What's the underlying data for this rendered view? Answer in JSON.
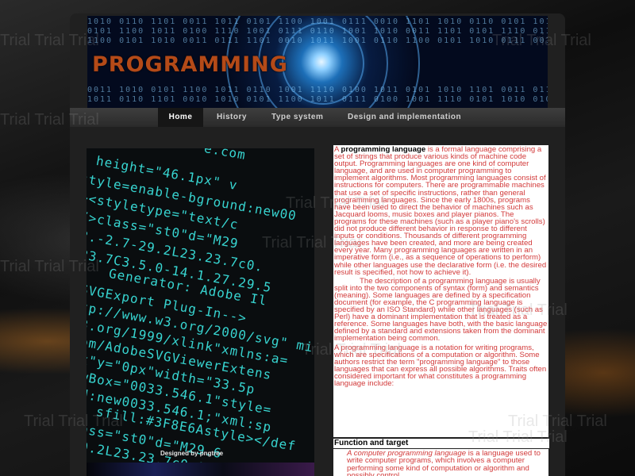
{
  "banner": {
    "title": "PROGRAMMING"
  },
  "nav": {
    "items": [
      {
        "label": "Home",
        "active": true
      },
      {
        "label": "History",
        "active": false
      },
      {
        "label": "Type system",
        "active": false
      },
      {
        "label": "Design and implementation",
        "active": false
      }
    ]
  },
  "photo": {
    "credit": "Designed by pngtree",
    "code_lines": [
      "e.com",
      "height=\"46.1px\" v",
      "style=enable-bground:new00",
      "><styletype=\"text/c",
      "/>class=\"st0\"d=\"M29",
      "2.-2.7-29.2L23.23.7c0.",
      "23.7C3.5.0-14.1.27.29.5",
      "Generator: Adobe Il",
      "SVGExport Plug-In-->",
      "tp://www.w3.org/2000/svg\" mi",
      "3.org/1999/xlink\"xmlns:a=",
      "om/AdobeSVGViewerExtens",
      "x\"y=\"0px\"width=\"33.5p",
      "wBox=\"0033.546.1\"style=",
      "d:new0033.546.1;\"xml:sp",
      "sfill:#3F8E6Astyle></def",
      "ass=\"st0\"d=\"M29.6",
      "9.2L23.23.7c0.0"
    ]
  },
  "article": {
    "intro_prefix": "A ",
    "intro_term": "programming language",
    "intro_rest": " is a formal language comprising a set of strings that produce various kinds of machine code output. Programming languages are one kind of computer language, and are used in computer programming to implement algorithms.     Most programming languages consist of instructions for computers. There are programmable machines that use a set of specific instructions, rather than general programming languages. Since the early 1800s, programs have been used to direct the behavior of machines such as Jacquard looms, music boxes and player pianos. The programs for these machines (such as a player piano's scrolls) did not produce different behavior in response to different inputs or conditions. Thousands of different programming languages have been created, and more are being created every year. Many programming languages are written in an imperative form (i.e., as a sequence of operations to perform) while other languages use the declarative form (i.e. the desired result is specified, not how to achieve it).",
    "paragraph2": "The description of a programming language is usually split into the two components of syntax (form) and semantics (meaning). Some languages are defined by a specification document (for example, the C programming language is specified by an ISO Standard) while other languages (such as Perl) have a dominant implementation that is treated as a reference. Some languages have both, with the basic language defined by a standard and extensions taken from the dominant implementation being common.",
    "paragraph3": "A programming language is a notation for writing programs, which are specifications of a computation or algorithm. Some authors restrict the term \"programming language\" to those languages that can express all possible algorithms. Traits often considered important for what constitutes a programming language include:"
  },
  "section": {
    "heading": "Function and target",
    "quote_em": "A computer programming language",
    "quote_rest": " is a language used to write computer programs, which involves a computer performing some kind of computation or algorithm and possibly control"
  },
  "watermark": {
    "text": "Trial"
  },
  "colors": {
    "link_red": "#d23a3a",
    "banner_title": "#b44a18",
    "code_cyan": "#37d4d0"
  }
}
